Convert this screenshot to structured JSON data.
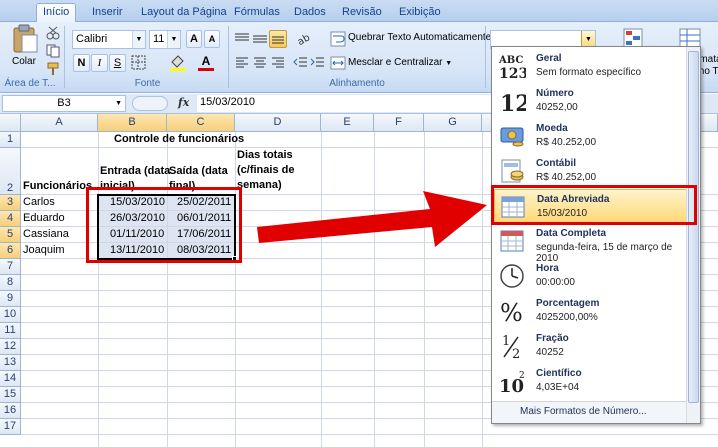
{
  "tabs": [
    "Início",
    "Inserir",
    "Layout da Página",
    "Fórmulas",
    "Dados",
    "Revisão",
    "Exibição"
  ],
  "ribbon": {
    "paste_label": "Colar",
    "group_clipboard": "Área de T...",
    "font_name": "Calibri",
    "font_size": "11",
    "grow_font": "A",
    "shrink_font": "A",
    "bold": "N",
    "italic": "I",
    "underline": "S",
    "font_color_letter": "A",
    "group_font": "Fonte",
    "wrap_text": "Quebrar Texto Automaticamente",
    "merge_center": "Mesclar e Centralizar",
    "group_alignment": "Alinhamento",
    "number_format_value": "",
    "right_partial": "rmatar\nmo Tabela"
  },
  "formula_bar": {
    "cell_ref": "B3",
    "fx": "fx",
    "value": "15/03/2010"
  },
  "grid": {
    "columns": [
      "A",
      "B",
      "C",
      "D",
      "E",
      "F",
      "G"
    ],
    "rows": [
      "1",
      "2",
      "3",
      "4",
      "5",
      "6",
      "7",
      "8",
      "9",
      "10",
      "11",
      "12",
      "13",
      "14",
      "15",
      "16",
      "17"
    ],
    "title": "Controle de funcionários",
    "header_a": "Funcionários",
    "header_b": "Entrada (data\ninicial)",
    "header_c": "Saída (data\nfinal)",
    "header_d": "Dias totais\n(c/finais de\nsemana)",
    "data": [
      {
        "name": "Carlos",
        "entry": "15/03/2010",
        "exit": "25/02/2011"
      },
      {
        "name": "Eduardo",
        "entry": "26/03/2010",
        "exit": "06/01/2011"
      },
      {
        "name": "Cassiana",
        "entry": "01/11/2010",
        "exit": "17/06/2011"
      },
      {
        "name": "Joaquim",
        "entry": "13/11/2010",
        "exit": "08/03/2011"
      }
    ]
  },
  "number_formats": [
    {
      "name": "Geral",
      "sample": "Sem formato específico",
      "icon": "abc-123-icon"
    },
    {
      "name": "Número",
      "sample": "40252,00",
      "icon": "number-12-icon"
    },
    {
      "name": "Moeda",
      "sample": "R$ 40.252,00",
      "icon": "currency-icon"
    },
    {
      "name": "Contábil",
      "sample": "R$ 40.252,00",
      "icon": "accounting-icon"
    },
    {
      "name": "Data Abreviada",
      "sample": "15/03/2010",
      "icon": "calendar-short-icon"
    },
    {
      "name": "Data Completa",
      "sample": "segunda-feira, 15 de março de 2010",
      "icon": "calendar-long-icon"
    },
    {
      "name": "Hora",
      "sample": "00:00:00",
      "icon": "clock-icon"
    },
    {
      "name": "Porcentagem",
      "sample": "4025200,00%",
      "icon": "percent-icon"
    },
    {
      "name": "Fração",
      "sample": "40252",
      "icon": "fraction-icon"
    },
    {
      "name": "Científico",
      "sample": "4,03E+04",
      "icon": "scientific-icon"
    }
  ],
  "more_formats": "Mais Formatos de Número...",
  "colors": {
    "annotation_red": "#e00000",
    "ribbon_text": "#15428b",
    "highlight": "#ffd978"
  }
}
